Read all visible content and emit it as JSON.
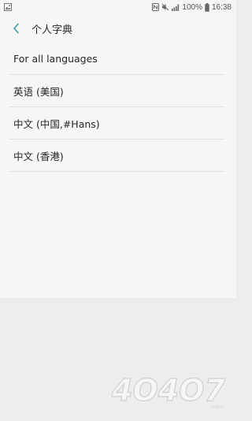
{
  "status_bar": {
    "battery_percent": "100%",
    "time": "16:38"
  },
  "header": {
    "title": "个人字典"
  },
  "languages": [
    {
      "label": "For all languages"
    },
    {
      "label": "英语 (美国)"
    },
    {
      "label": "中文 (中国,#Hans)"
    },
    {
      "label": "中文 (香港)"
    }
  ],
  "watermark": {
    "text": "4O4O7"
  }
}
